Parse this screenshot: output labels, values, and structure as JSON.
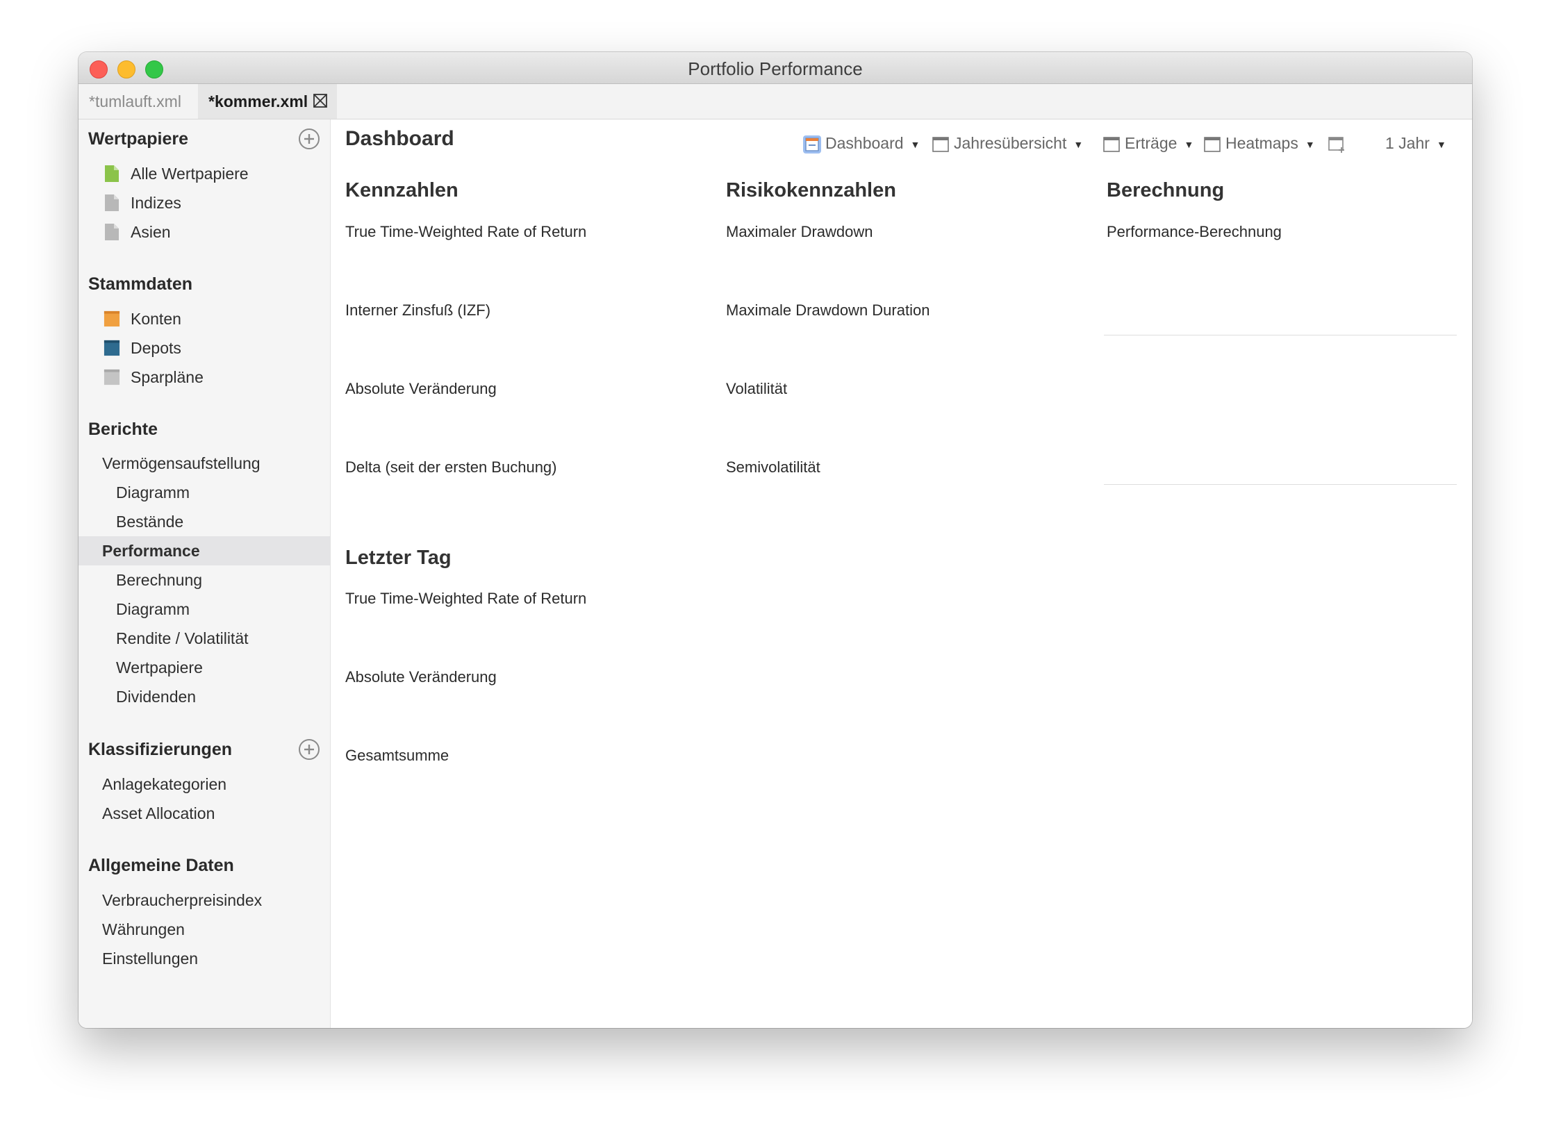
{
  "window": {
    "title": "Portfolio Performance",
    "tabs": [
      {
        "label": "*tumlauft.xml",
        "active": false
      },
      {
        "label": "*kommer.xml",
        "active": true
      }
    ]
  },
  "sidebar": {
    "sections": [
      {
        "title": "Wertpapiere",
        "has_add": true,
        "items": [
          {
            "label": "Alle Wertpapiere",
            "icon": "document-green-icon"
          },
          {
            "label": "Indizes",
            "icon": "document-gray-icon"
          },
          {
            "label": "Asien",
            "icon": "document-gray-icon"
          }
        ]
      },
      {
        "title": "Stammdaten",
        "has_add": false,
        "items": [
          {
            "label": "Konten",
            "icon": "account-orange-icon"
          },
          {
            "label": "Depots",
            "icon": "portfolio-blue-icon"
          },
          {
            "label": "Sparpläne",
            "icon": "savings-plan-gray-icon"
          }
        ]
      },
      {
        "title": "Berichte",
        "has_add": false,
        "items": [
          {
            "label": "Vermögensaufstellung"
          },
          {
            "label": "Diagramm"
          },
          {
            "label": "Bestände"
          },
          {
            "label": "Performance",
            "selected": true
          },
          {
            "label": "Berechnung"
          },
          {
            "label": "Diagramm"
          },
          {
            "label": "Rendite / Volatilität"
          },
          {
            "label": "Wertpapiere"
          },
          {
            "label": "Dividenden"
          }
        ]
      },
      {
        "title": "Klassifizierungen",
        "has_add": true,
        "items": [
          {
            "label": "Anlagekategorien"
          },
          {
            "label": "Asset Allocation"
          }
        ]
      },
      {
        "title": "Allgemeine Daten",
        "has_add": false,
        "items": [
          {
            "label": "Verbraucherpreisindex"
          },
          {
            "label": "Währungen"
          },
          {
            "label": "Einstellungen"
          }
        ]
      }
    ]
  },
  "main": {
    "title": "Dashboard",
    "toolbar": [
      {
        "label": "Dashboard",
        "icon": "dashboard-active-icon",
        "active": true
      },
      {
        "label": "Jahresübersicht",
        "icon": "dashboard-icon"
      },
      {
        "label": "Erträge",
        "icon": "dashboard-icon"
      },
      {
        "label": "Heatmaps",
        "icon": "dashboard-icon"
      },
      {
        "label": "",
        "icon": "new-dashboard-icon"
      },
      {
        "label": "1 Jahr"
      }
    ],
    "settings_icon": "gear-icon",
    "columns": [
      {
        "heading": "Kennzahlen",
        "metrics": [
          "True Time-Weighted Rate of Return",
          "Interner Zinsfuß (IZF)",
          "Absolute Veränderung",
          "Delta (seit der ersten Buchung)"
        ]
      },
      {
        "heading": "Risikokennzahlen",
        "metrics": [
          "Maximaler Drawdown",
          "Maximale Drawdown Duration",
          "Volatilität",
          "Semivolatilität"
        ]
      },
      {
        "heading": "Berechnung",
        "metrics": [
          "Performance-Berechnung"
        ]
      }
    ],
    "last_day": {
      "heading": "Letzter Tag",
      "metrics": [
        "True Time-Weighted Rate of Return",
        "Absolute Veränderung",
        "Gesamtsumme"
      ]
    }
  }
}
